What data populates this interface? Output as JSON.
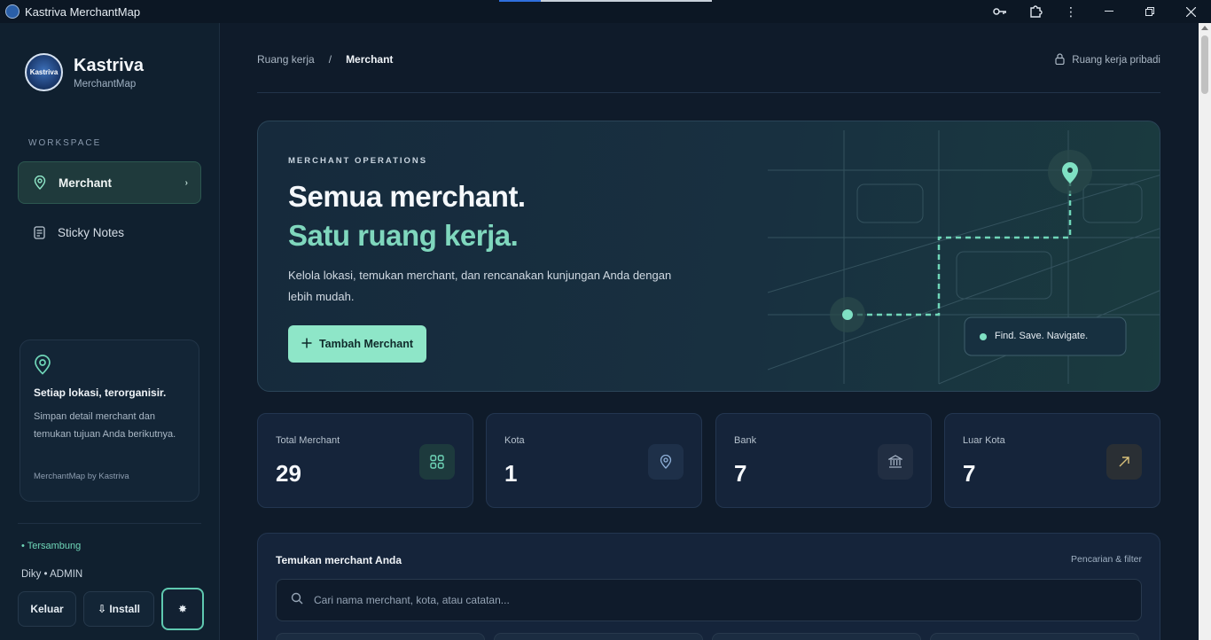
{
  "window": {
    "title": "Kastriva MerchantMap"
  },
  "brand": {
    "name": "Kastriva",
    "subtitle": "MerchantMap",
    "logo_text": "Kastriva"
  },
  "sidebar": {
    "section_label": "WORKSPACE",
    "items": [
      {
        "label": "Merchant",
        "icon": "map-pin-icon",
        "active": true
      },
      {
        "label": "Sticky Notes",
        "icon": "note-icon",
        "active": false
      }
    ],
    "info_card": {
      "title": "Setiap lokasi, terorganisir.",
      "description": "Simpan detail merchant dan temukan tujuan Anda berikutnya.",
      "footer": "MerchantMap by Kastriva"
    },
    "status": "• Tersambung",
    "user": "Diky • ADMIN",
    "buttons": {
      "logout": "Keluar",
      "install": "⇩ Install",
      "theme": "✸"
    }
  },
  "breadcrumb": {
    "parent": "Ruang kerja",
    "separator": "/",
    "current": "Merchant"
  },
  "workspace_note": "Ruang kerja pribadi",
  "hero": {
    "eyebrow": "MERCHANT OPERATIONS",
    "title_line1": "Semua merchant.",
    "title_line2": "Satu ruang kerja.",
    "description": "Kelola lokasi, temukan merchant, dan rencanakan kunjungan Anda dengan lebih mudah.",
    "cta_label": "Tambah Merchant",
    "map_tag": "Find. Save. Navigate."
  },
  "stats": [
    {
      "label": "Total Merchant",
      "value": "29",
      "icon": "grid-icon",
      "color": "#6fd6b8"
    },
    {
      "label": "Kota",
      "value": "1",
      "icon": "map-pin-icon",
      "color": "#8fb0d8"
    },
    {
      "label": "Bank",
      "value": "7",
      "icon": "bank-icon",
      "color": "#a9b6c8"
    },
    {
      "label": "Luar Kota",
      "value": "7",
      "icon": "arrow-up-right-icon",
      "color": "#d8c07a"
    }
  ],
  "search": {
    "title": "Temukan merchant Anda",
    "link": "Pencarian & filter",
    "placeholder": "Cari nama merchant, kota, atau catatan..."
  },
  "colors": {
    "accent": "#8ee6c8",
    "accent_text": "#7fd7bd",
    "background": "#0f1b2a"
  }
}
